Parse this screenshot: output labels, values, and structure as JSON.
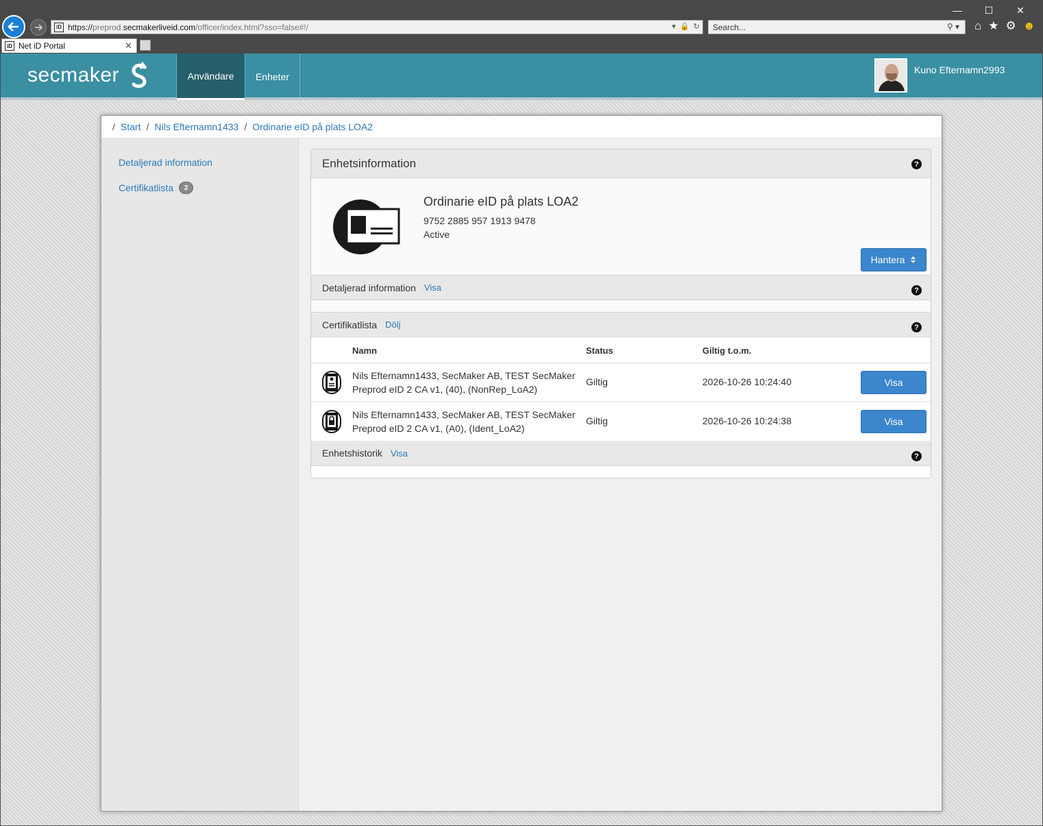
{
  "browser": {
    "url_prefix": "https://",
    "url_dim1": "preprod.",
    "url_host": "secmakerliveid.com",
    "url_path": "/officer/index.html?sso=false#!/",
    "favicon_text": "iD",
    "search_placeholder": "Search...",
    "tab_title": "Net iD Portal"
  },
  "app": {
    "logo_text": "secmaker",
    "nav": [
      {
        "label": "Användare",
        "active": true
      },
      {
        "label": "Enheter",
        "active": false
      }
    ],
    "user_name": "Kuno Efternamn2993"
  },
  "breadcrumb": [
    "Start",
    "Nils Efternamn1433",
    "Ordinarie eID på plats LOA2"
  ],
  "sidebar": {
    "items": [
      {
        "label": "Detaljerad information"
      },
      {
        "label": "Certifikatlista",
        "badge": "2"
      }
    ]
  },
  "panel": {
    "title": "Enhetsinformation",
    "help": "?",
    "device": {
      "name": "Ordinarie eID på plats LOA2",
      "serial": "9752 2885 957 1913 9478",
      "status": "Active",
      "manage_label": "Hantera"
    },
    "details": {
      "label": "Detaljerad information",
      "action": "Visa"
    },
    "certs": {
      "label": "Certifikatlista",
      "action": "Dölj",
      "columns": [
        "Namn",
        "Status",
        "Giltig t.o.m."
      ],
      "rows": [
        {
          "name_line1": "Nils Efternamn1433, SecMaker AB, TEST SecMaker",
          "name_line2": "Preprod eID 2 CA v1, (40), (NonRep_LoA2)",
          "status": "Giltig",
          "valid_to": "2026-10-26 10:24:40",
          "action": "Visa",
          "icon": "signing-certificate-icon"
        },
        {
          "name_line1": "Nils Efternamn1433, SecMaker AB, TEST SecMaker",
          "name_line2": "Preprod eID 2 CA v1, (A0), (Ident_LoA2)",
          "status": "Giltig",
          "valid_to": "2026-10-26 10:24:38",
          "action": "Visa",
          "icon": "auth-certificate-icon"
        }
      ]
    },
    "history": {
      "label": "Enhetshistorik",
      "action": "Visa"
    }
  },
  "colors": {
    "appbar": "#3a8fa3",
    "nav_active": "#265f6c",
    "link": "#2a7ab8",
    "button": "#3b86cc"
  }
}
